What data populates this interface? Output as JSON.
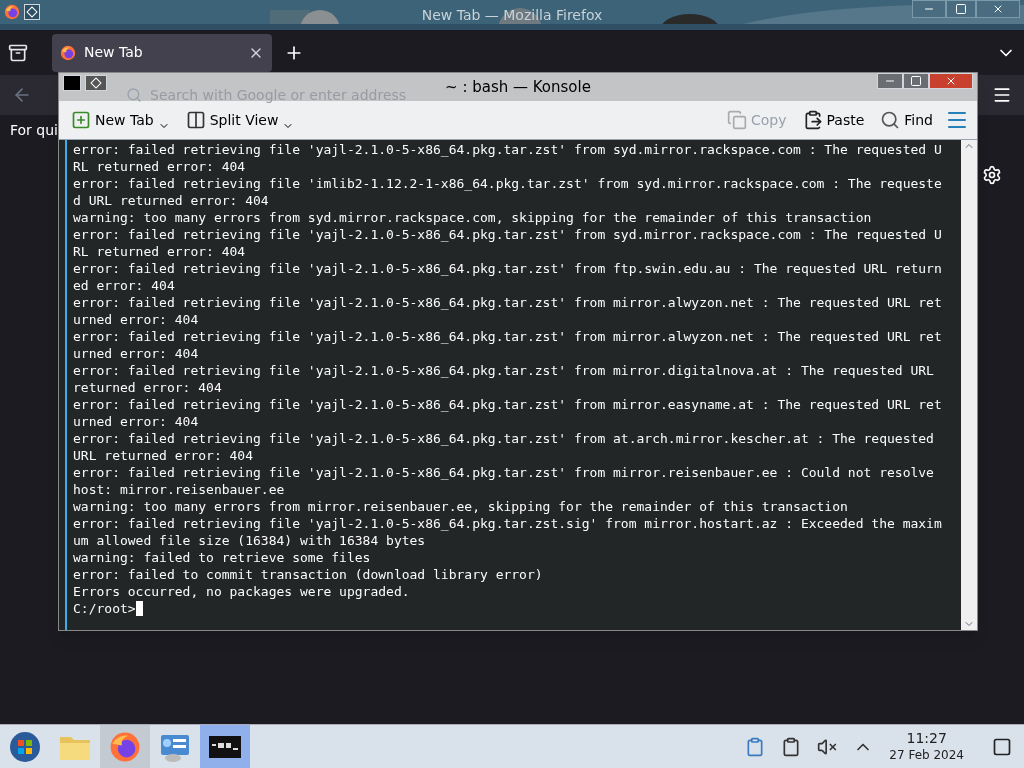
{
  "firefox": {
    "title": "New Tab — Mozilla Firefox",
    "tabs": [
      {
        "label": "New Tab",
        "selected": true
      }
    ],
    "search": {
      "placeholder": "Search with Google or enter address"
    },
    "page_text": "For qui"
  },
  "konsole": {
    "title": "~ : bash — Konsole",
    "toolbar": [
      {
        "label": "New Tab",
        "kind": "newtab",
        "disabled": false,
        "menu": true
      },
      {
        "label": "Split View",
        "kind": "split",
        "disabled": false,
        "menu": true
      },
      {
        "label": "Copy",
        "kind": "copy",
        "disabled": true,
        "menu": false
      },
      {
        "label": "Paste",
        "kind": "paste",
        "disabled": false,
        "menu": false
      },
      {
        "label": "Find",
        "kind": "find",
        "disabled": false,
        "menu": false
      }
    ],
    "lines": [
      "error: failed retrieving file 'yajl-2.1.0-5-x86_64.pkg.tar.zst' from syd.mirror.rackspace.com : The requested U",
      "RL returned error: 404",
      "error: failed retrieving file 'imlib2-1.12.2-1-x86_64.pkg.tar.zst' from syd.mirror.rackspace.com : The requeste",
      "d URL returned error: 404",
      "warning: too many errors from syd.mirror.rackspace.com, skipping for the remainder of this transaction",
      "error: failed retrieving file 'yajl-2.1.0-5-x86_64.pkg.tar.zst' from syd.mirror.rackspace.com : The requested U",
      "RL returned error: 404",
      "error: failed retrieving file 'yajl-2.1.0-5-x86_64.pkg.tar.zst' from ftp.swin.edu.au : The requested URL return",
      "ed error: 404",
      "error: failed retrieving file 'yajl-2.1.0-5-x86_64.pkg.tar.zst' from mirror.alwyzon.net : The requested URL ret",
      "urned error: 404",
      "error: failed retrieving file 'yajl-2.1.0-5-x86_64.pkg.tar.zst' from mirror.alwyzon.net : The requested URL ret",
      "urned error: 404",
      "error: failed retrieving file 'yajl-2.1.0-5-x86_64.pkg.tar.zst' from mirror.digitalnova.at : The requested URL",
      "returned error: 404",
      "error: failed retrieving file 'yajl-2.1.0-5-x86_64.pkg.tar.zst' from mirror.easyname.at : The requested URL ret",
      "urned error: 404",
      "error: failed retrieving file 'yajl-2.1.0-5-x86_64.pkg.tar.zst' from at.arch.mirror.kescher.at : The requested",
      "URL returned error: 404",
      "error: failed retrieving file 'yajl-2.1.0-5-x86_64.pkg.tar.zst' from mirror.reisenbauer.ee : Could not resolve",
      "host: mirror.reisenbauer.ee",
      "warning: too many errors from mirror.reisenbauer.ee, skipping for the remainder of this transaction",
      "error: failed retrieving file 'yajl-2.1.0-5-x86_64.pkg.tar.zst.sig' from mirror.hostart.az : Exceeded the maxim",
      "um allowed file size (16384) with 16384 bytes",
      "warning: failed to retrieve some files",
      "error: failed to commit transaction (download library error)",
      "Errors occurred, no packages were upgraded."
    ],
    "prompt": "C:/root>"
  },
  "taskbar": {
    "apps": [
      {
        "kind": "start",
        "selected": false
      },
      {
        "kind": "folder",
        "selected": false
      },
      {
        "kind": "firefox",
        "selected": true
      },
      {
        "kind": "panel",
        "selected": false
      },
      {
        "kind": "terminal",
        "selected": true
      }
    ],
    "time": "11:27",
    "date": "27 Feb 2024"
  }
}
